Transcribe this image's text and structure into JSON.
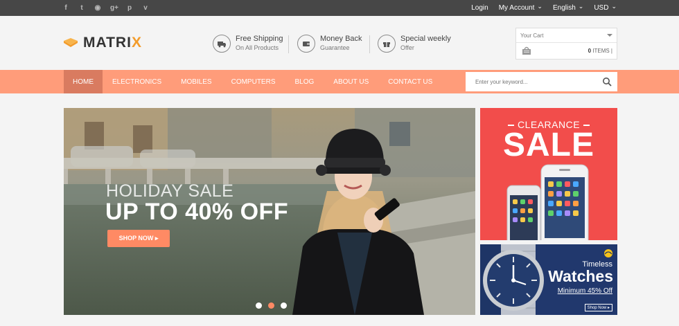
{
  "social": [
    {
      "icon": "facebook-icon",
      "glyph": "f"
    },
    {
      "icon": "twitter-icon",
      "glyph": "t"
    },
    {
      "icon": "rss-icon",
      "glyph": "◉"
    },
    {
      "icon": "google-plus-icon",
      "glyph": "g+"
    },
    {
      "icon": "pinterest-icon",
      "glyph": "p"
    },
    {
      "icon": "vine-icon",
      "glyph": "v"
    }
  ],
  "topbar": {
    "login": "Login",
    "account": "My Account",
    "language": "English",
    "currency": "USD"
  },
  "logo": {
    "part1": "MATRI",
    "part2": "X"
  },
  "features": [
    {
      "icon": "truck-icon",
      "title": "Free Shipping",
      "subtitle": "On All Products"
    },
    {
      "icon": "wallet-icon",
      "title": "Money Back",
      "subtitle": "Guarantee"
    },
    {
      "icon": "gift-icon",
      "title": "Special weekly",
      "subtitle": "Offer"
    }
  ],
  "cart": {
    "label": "Your Cart",
    "count": "0",
    "items_label": "ITEMS |"
  },
  "nav": {
    "items": [
      "HOME",
      "ELECTRONICS",
      "MOBILES",
      "COMPUTERS",
      "BLOG",
      "ABOUT US",
      "CONTACT US"
    ],
    "active_index": 0
  },
  "search": {
    "placeholder": "Enter your keyword..."
  },
  "hero": {
    "subtitle": "HOLIDAY SALE",
    "title": "UP TO 40% OFF",
    "button": "SHOP NOW ▸",
    "slides": 3,
    "active_slide": 1
  },
  "promo_sale": {
    "tag": "CLEARANCE",
    "title": "SALE"
  },
  "promo_watches": {
    "line1": "Timeless",
    "line2": "Watches",
    "line3": "Minimum 45% Off",
    "button": "Shop Now ▸"
  },
  "colors": {
    "topbar": "#474747",
    "nav": "#ff9c7a",
    "nav_active": "#d97b60",
    "accent": "#ff8a64",
    "sale_red": "#f24d4b",
    "watch_navy": "#1e3566",
    "logo_orange": "#f39c2b"
  }
}
